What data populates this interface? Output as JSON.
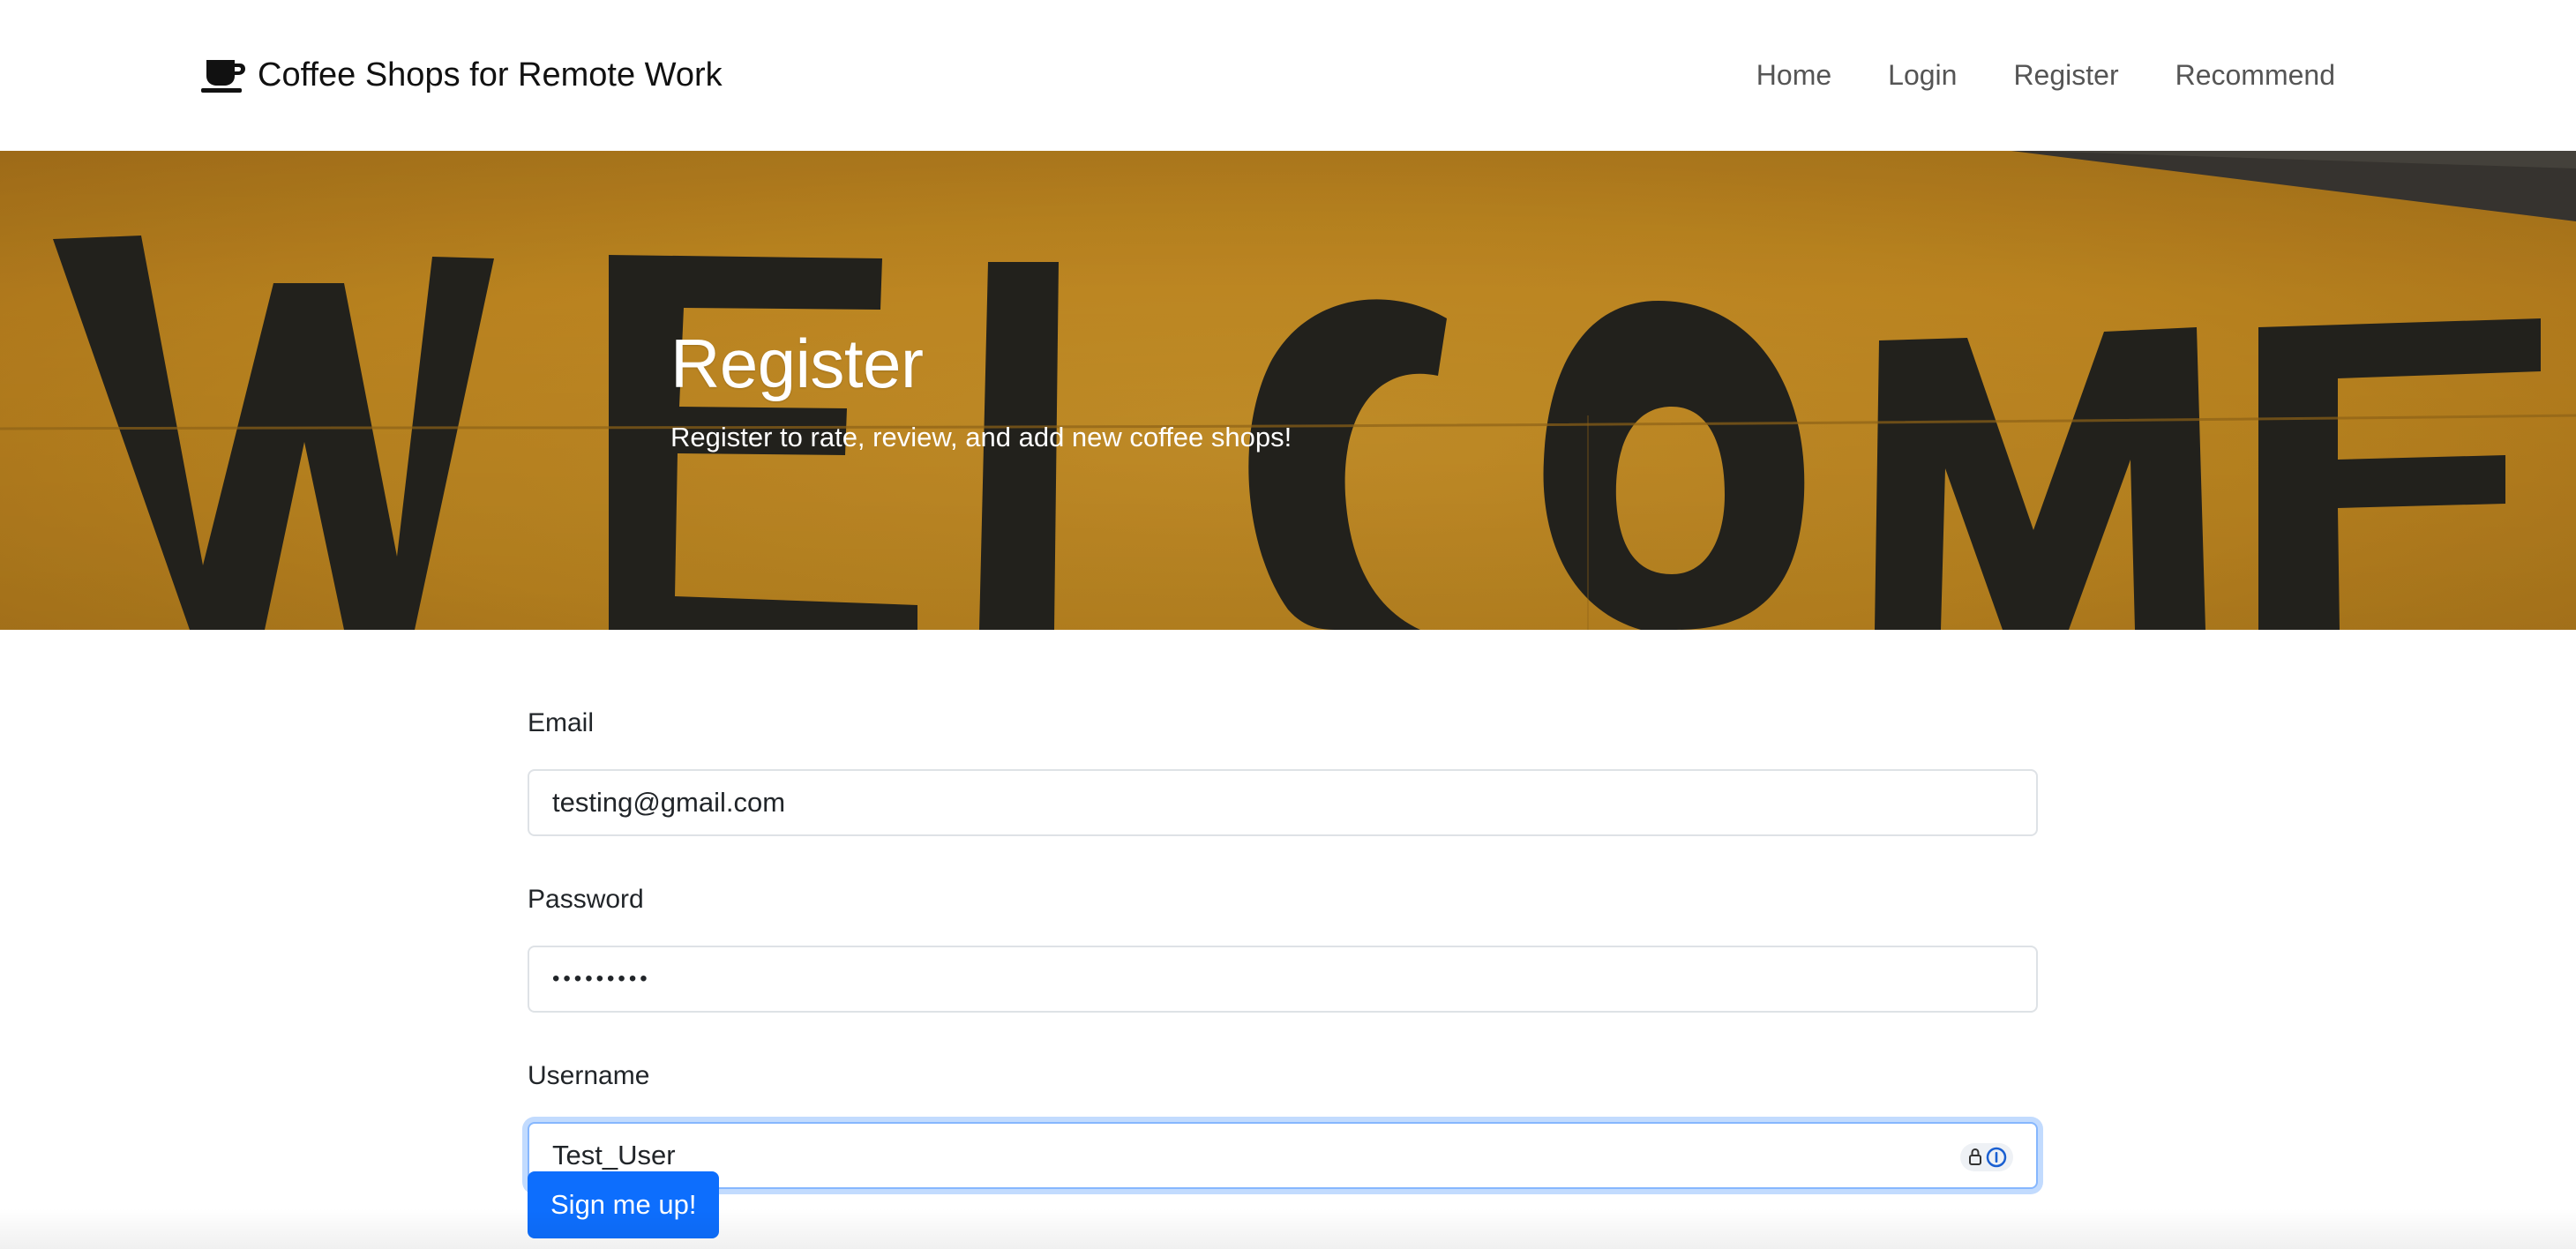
{
  "nav": {
    "brand_icon": "coffee-cup-icon",
    "brand_text": "Coffee Shops for Remote Work",
    "links": [
      {
        "label": "Home"
      },
      {
        "label": "Login"
      },
      {
        "label": "Register"
      },
      {
        "label": "Recommend"
      }
    ]
  },
  "hero": {
    "background_text": "WELCOME",
    "background_color": "#c98e22",
    "title": "Register",
    "subtitle": "Register to rate, review, and add new coffee shops!"
  },
  "form": {
    "email": {
      "label": "Email",
      "value": "testing@gmail.com"
    },
    "password": {
      "label": "Password",
      "value": "•••••••••"
    },
    "username": {
      "label": "Username",
      "value": "Test_User",
      "icon": "password-manager-icon"
    },
    "submit_label": "Sign me up!"
  },
  "colors": {
    "primary": "#0d6efd",
    "focus_ring": "#86b7fe"
  }
}
